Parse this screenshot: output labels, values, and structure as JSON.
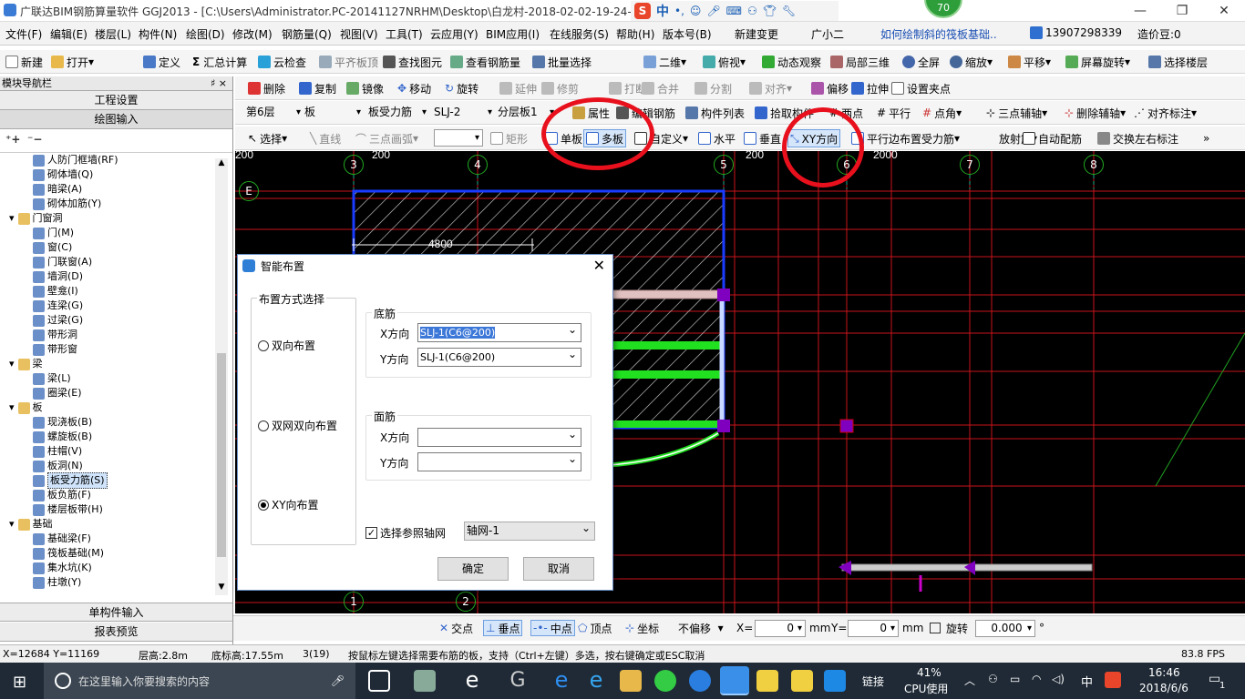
{
  "title_bar": {
    "title": "广联达BIM钢筋算量软件 GGJ2013 - [C:\\Users\\Administrator.PC-20141127NRHM\\Desktop\\白龙村-2018-02-02-19-24-35(2666版).GGJ12]",
    "badge": "70"
  },
  "ime_bar": {
    "label": "中"
  },
  "menu": [
    "文件(F)",
    "编辑(E)",
    "楼层(L)",
    "构件(N)",
    "绘图(D)",
    "修改(M)",
    "钢筋量(Q)",
    "视图(V)",
    "工具(T)",
    "云应用(Y)",
    "BIM应用(I)",
    "在线服务(S)",
    "帮助(H)",
    "版本号(B)",
    "新建变更",
    "广小二"
  ],
  "menu_right": {
    "link": "如何绘制斜的筏板基础..",
    "phone": "13907298339",
    "price": "造价豆:0"
  },
  "toolbar1": [
    "新建",
    "打开",
    "定义",
    "汇总计算",
    "云检查",
    "平齐板顶",
    "查找图元",
    "查看钢筋量",
    "批量选择",
    "二维",
    "俯视",
    "动态观察",
    "局部三维",
    "全屏",
    "缩放",
    "平移",
    "屏幕旋转",
    "选择楼层"
  ],
  "toolbar2": [
    "删除",
    "复制",
    "镜像",
    "移动",
    "旋转",
    "延伸",
    "修剪",
    "打断",
    "合并",
    "分割",
    "对齐",
    "偏移",
    "拉伸",
    "设置夹点"
  ],
  "toolbar3": {
    "floor": "第6层",
    "type": "板",
    "sub": "板受力筋",
    "code": "SLJ-2",
    "layer": "分层板1",
    "items": [
      "属性",
      "编辑钢筋",
      "构件列表",
      "拾取构件",
      "两点",
      "平行",
      "点角",
      "三点辅轴",
      "删除辅轴",
      "对齐标注"
    ]
  },
  "toolbar4": [
    "选择",
    "直线",
    "三点画弧",
    "矩形",
    "单板",
    "多板",
    "自定义",
    "水平",
    "垂直",
    "XY方向",
    "平行边布置受力筋",
    "放射筋",
    "自动配筋",
    "交换左右标注"
  ],
  "left_panel": {
    "header": "模块导航栏",
    "pin": "♯ ×",
    "btn_project": "工程设置",
    "btn_draw": "绘图输入",
    "tree": [
      {
        "label": "人防门框墙(RF)",
        "level": 2
      },
      {
        "label": "砌体墙(Q)",
        "level": 2
      },
      {
        "label": "暗梁(A)",
        "level": 2
      },
      {
        "label": "砌体加筋(Y)",
        "level": 2
      },
      {
        "label": "门窗洞",
        "level": 1
      },
      {
        "label": "门(M)",
        "level": 2
      },
      {
        "label": "窗(C)",
        "level": 2
      },
      {
        "label": "门联窗(A)",
        "level": 2
      },
      {
        "label": "墙洞(D)",
        "level": 2
      },
      {
        "label": "壁龛(I)",
        "level": 2
      },
      {
        "label": "连梁(G)",
        "level": 2
      },
      {
        "label": "过梁(G)",
        "level": 2
      },
      {
        "label": "带形洞",
        "level": 2
      },
      {
        "label": "带形窗",
        "level": 2
      },
      {
        "label": "梁",
        "level": 1
      },
      {
        "label": "梁(L)",
        "level": 2
      },
      {
        "label": "圈梁(E)",
        "level": 2
      },
      {
        "label": "板",
        "level": 1
      },
      {
        "label": "现浇板(B)",
        "level": 2
      },
      {
        "label": "螺旋板(B)",
        "level": 2
      },
      {
        "label": "柱帽(V)",
        "level": 2
      },
      {
        "label": "板洞(N)",
        "level": 2
      },
      {
        "label": "板受力筋(S)",
        "level": 2,
        "selected": true
      },
      {
        "label": "板负筋(F)",
        "level": 2
      },
      {
        "label": "楼层板带(H)",
        "level": 2
      },
      {
        "label": "基础",
        "level": 1
      },
      {
        "label": "基础梁(F)",
        "level": 2
      },
      {
        "label": "筏板基础(M)",
        "level": 2
      },
      {
        "label": "集水坑(K)",
        "level": 2
      },
      {
        "label": "柱墩(Y)",
        "level": 2
      }
    ],
    "btn_single": "单构件输入",
    "btn_report": "报表预览"
  },
  "canvas": {
    "axes_top": [
      "3",
      "4",
      "5",
      "6",
      "7",
      "8"
    ],
    "axes_bottom": [
      "1",
      "2"
    ],
    "axis_left": "E",
    "dim_labels": [
      "200",
      "200",
      "200",
      "4800",
      "2000"
    ]
  },
  "dialog": {
    "title": "智能布置",
    "group_mode": "布置方式选择",
    "radio1": "双向布置",
    "radio2": "双网双向布置",
    "radio3": "XY向布置",
    "group_bottom": "底筋",
    "x_label": "X方向",
    "y_label": "Y方向",
    "bottom_x": "SLJ-1(C6@200)",
    "bottom_y": "SLJ-1(C6@200)",
    "group_top": "面筋",
    "top_x_label": "X方向",
    "top_y_label": "Y方向",
    "checkbox": "选择参照轴网",
    "grid": "轴网-1",
    "ok": "确定",
    "cancel": "取消"
  },
  "snap_bar": {
    "items": [
      "交点",
      "垂点",
      "中点",
      "顶点",
      "坐标"
    ],
    "offset": "不偏移",
    "x_label": "X=",
    "x_val": "0",
    "mm1": "mm",
    "y_label": "Y=",
    "y_val": "0",
    "mm2": "mm",
    "rotate": "旋转",
    "rot_val": "0.000",
    "deg": "°"
  },
  "status_bar": {
    "coords": "X=12684 Y=11169",
    "floor_h": "层高:2.8m",
    "base_h": "底标高:17.55m",
    "count": "3(19)",
    "hint": "按鼠标左键选择需要布筋的板，支持（Ctrl+左键）多选，按右键确定或ESC取消",
    "fps": "83.8 FPS"
  },
  "taskbar": {
    "search": "在这里输入你要搜索的内容",
    "link": "链接",
    "cpu_pct": "41%",
    "cpu_label": "CPU使用",
    "ime": "中",
    "time": "16:46",
    "date": "2018/6/6",
    "notif": "1"
  },
  "colors": {
    "accent": "#e8101c",
    "canvas_bg": "#000000",
    "grid_red": "#c8141c",
    "slab_green": "#20e020",
    "magenta": "#8000c0"
  }
}
